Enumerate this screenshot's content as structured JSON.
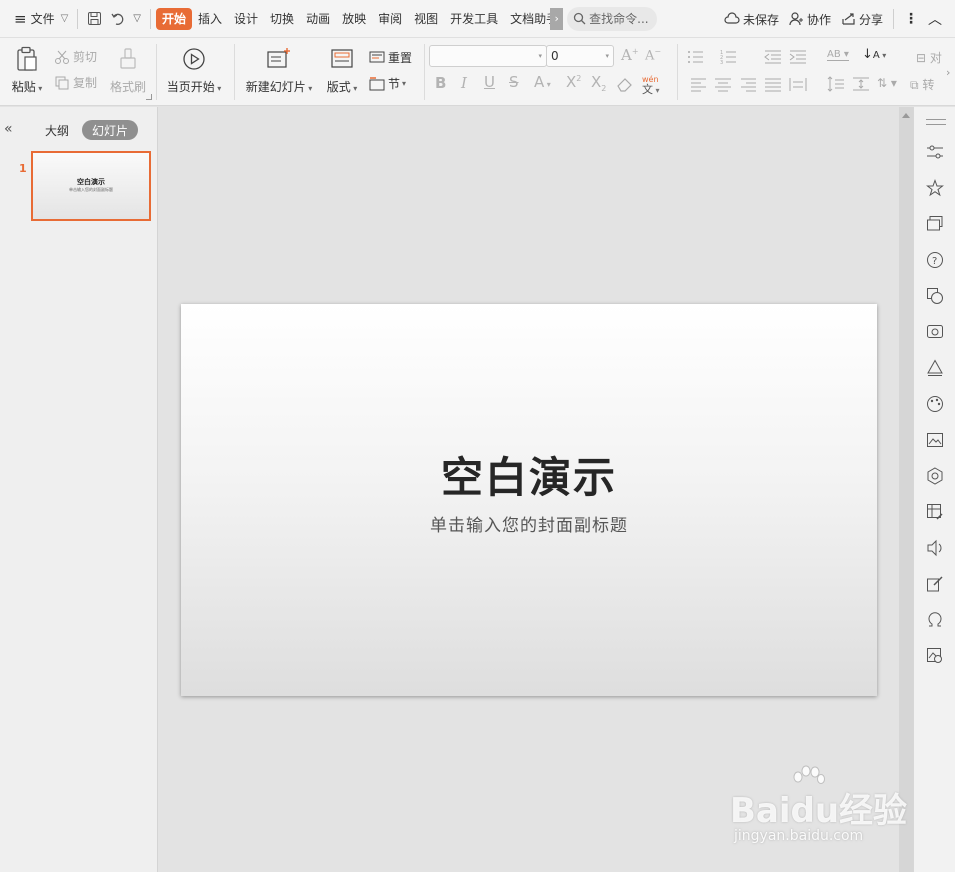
{
  "menubar": {
    "file_label": "文件",
    "tabs": [
      {
        "label": "开始",
        "active": true
      },
      {
        "label": "插入"
      },
      {
        "label": "设计"
      },
      {
        "label": "切换"
      },
      {
        "label": "动画"
      },
      {
        "label": "放映"
      },
      {
        "label": "审阅"
      },
      {
        "label": "视图"
      },
      {
        "label": "开发工具"
      },
      {
        "label": "文档助手"
      }
    ],
    "search_placeholder": "查找命令...",
    "unsaved_label": "未保存",
    "collab_label": "协作",
    "share_label": "分享"
  },
  "ribbon": {
    "paste": "粘贴",
    "cut": "剪切",
    "copy": "复制",
    "format_painter": "格式刷",
    "from_current": "当页开始",
    "new_slide": "新建幻灯片",
    "layout": "版式",
    "reset": "重置",
    "section": "节",
    "font_size_value": "0",
    "font_name_value": ""
  },
  "left_panel": {
    "tab_outline": "大纲",
    "tab_slides": "幻灯片",
    "slide_number": "1",
    "thumb_title": "空白演示",
    "thumb_subtitle": "单击输入您的封面副标题"
  },
  "slide": {
    "title": "空白演示",
    "subtitle": "单击输入您的封面副标题"
  },
  "watermark": {
    "brand": "Baidu经验",
    "url": "jingyan.baidu.com"
  },
  "colors": {
    "accent": "#e86b35"
  }
}
